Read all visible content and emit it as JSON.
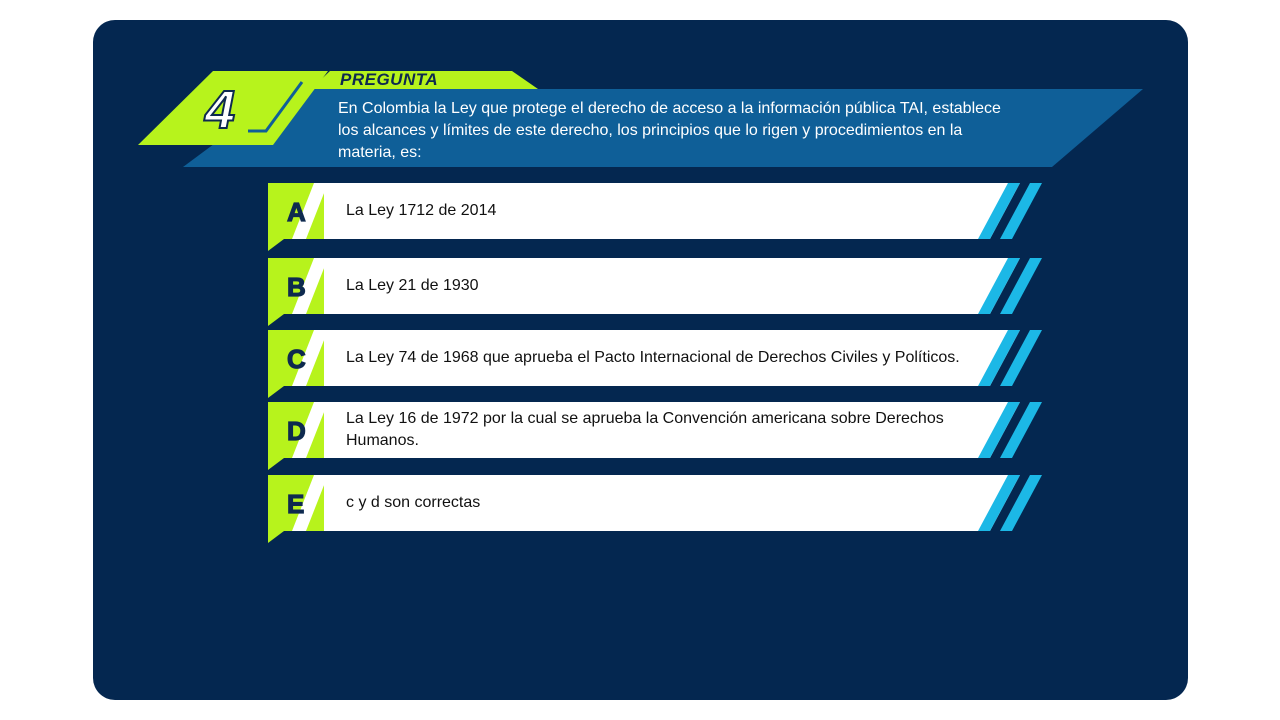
{
  "question": {
    "number": "4",
    "label": "PREGUNTA",
    "text": "En Colombia la Ley que protege el derecho de acceso a la información pública TAI, establece los alcances y límites de este derecho, los principios que lo rigen y procedimientos en la materia, es:"
  },
  "options": [
    {
      "letter": "A",
      "text": "La Ley 1712 de 2014"
    },
    {
      "letter": "B",
      "text": "La Ley 21 de 1930"
    },
    {
      "letter": "C",
      "text": "La Ley 74 de 1968 que aprueba el Pacto Internacional de Derechos Civiles y Políticos."
    },
    {
      "letter": "D",
      "text": "La Ley 16 de 1972 por la cual se aprueba la Convención americana sobre Derechos Humanos."
    },
    {
      "letter": "E",
      "text": "c y d son correctas"
    }
  ],
  "colors": {
    "background": "#042750",
    "accent_green": "#b7f31c",
    "accent_blue": "#0f5f98",
    "accent_cyan": "#1cb8e6",
    "option_bg": "#ffffff"
  }
}
